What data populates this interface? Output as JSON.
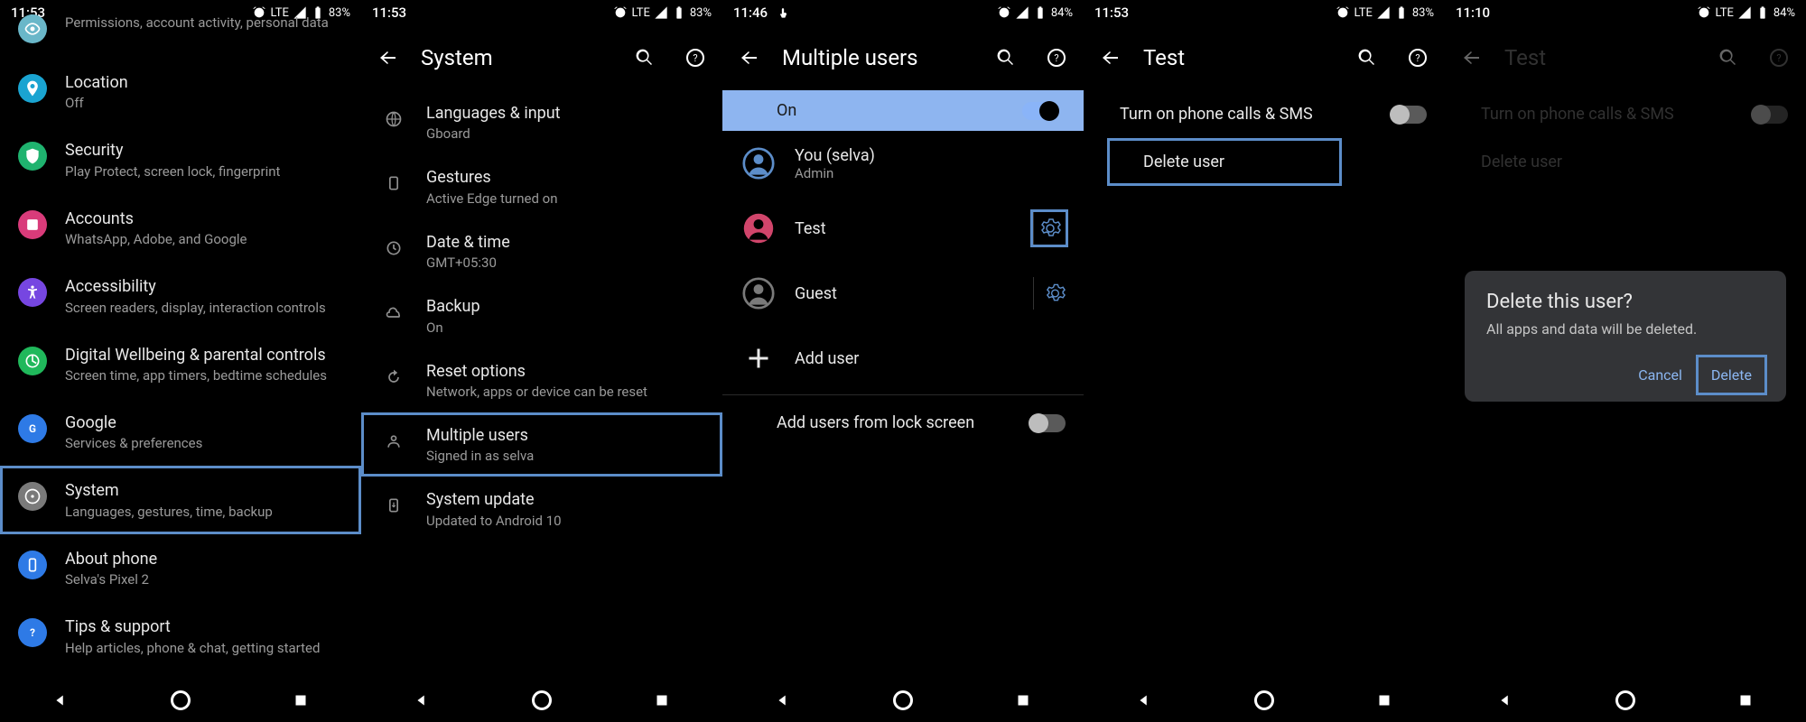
{
  "screens": [
    {
      "status": {
        "time": "11:53",
        "net": "LTE",
        "battery": "83%",
        "touch": false
      },
      "items": [
        {
          "icon_bg": "#6ab7c9",
          "label": "",
          "sub": "Permissions, account activity, personal data"
        },
        {
          "icon_bg": "#1aa4d1",
          "label": "Location",
          "sub": "Off"
        },
        {
          "icon_bg": "#1fb36f",
          "label": "Security",
          "sub": "Play Protect, screen lock, fingerprint"
        },
        {
          "icon_bg": "#d93b7a",
          "label": "Accounts",
          "sub": "WhatsApp, Adobe, and Google"
        },
        {
          "icon_bg": "#7646e1",
          "label": "Accessibility",
          "sub": "Screen readers, display, interaction controls"
        },
        {
          "icon_bg": "#20b85b",
          "label": "Digital Wellbeing & parental controls",
          "sub": "Screen time, app timers, bedtime schedules"
        },
        {
          "icon_bg": "#2e7ae6",
          "label": "Google",
          "sub": "Services & preferences"
        },
        {
          "icon_bg": "#7a7a7a",
          "label": "System",
          "sub": "Languages, gestures, time, backup",
          "hl": true
        },
        {
          "icon_bg": "#2e7ae6",
          "label": "About phone",
          "sub": "Selva's Pixel 2"
        },
        {
          "icon_bg": "#2e7ae6",
          "label": "Tips & support",
          "sub": "Help articles, phone & chat, getting started"
        }
      ]
    },
    {
      "status": {
        "time": "11:53",
        "net": "LTE",
        "battery": "83%",
        "touch": false
      },
      "title": "System",
      "items": [
        {
          "label": "Languages & input",
          "sub": "Gboard"
        },
        {
          "label": "Gestures",
          "sub": "Active Edge turned on"
        },
        {
          "label": "Date & time",
          "sub": "GMT+05:30"
        },
        {
          "label": "Backup",
          "sub": "On"
        },
        {
          "label": "Reset options",
          "sub": "Network, apps or device can be reset"
        },
        {
          "label": "Multiple users",
          "sub": "Signed in as selva",
          "hl": true
        },
        {
          "label": "System update",
          "sub": "Updated to Android 10"
        }
      ]
    },
    {
      "status": {
        "time": "11:46",
        "net": "",
        "battery": "84%",
        "touch": true
      },
      "title": "Multiple users",
      "toggle": {
        "label": "On",
        "state": "on"
      },
      "users": [
        {
          "name": "You (selva)",
          "sub": "Admin",
          "avatar": "you"
        },
        {
          "name": "Test",
          "sub": "",
          "avatar": "test",
          "gear_hl": true
        },
        {
          "name": "Guest",
          "sub": "",
          "avatar": "guest",
          "gear": true
        }
      ],
      "add": {
        "label": "Add user"
      },
      "lock": {
        "label": "Add users from lock screen",
        "state": "off"
      }
    },
    {
      "status": {
        "time": "11:53",
        "net": "LTE",
        "battery": "83%",
        "touch": false
      },
      "title": "Test",
      "items": [
        {
          "label": "Turn on phone calls & SMS",
          "switch": "off"
        },
        {
          "label": "Delete user",
          "hl": true
        }
      ]
    },
    {
      "status": {
        "time": "11:10",
        "net": "LTE",
        "battery": "84%",
        "touch": false
      },
      "title": "Test",
      "dim": true,
      "items": [
        {
          "label": "Turn on phone calls & SMS",
          "switch": "off"
        },
        {
          "label": "Delete user"
        }
      ],
      "dialog": {
        "title": "Delete this user?",
        "msg": "All apps and data will be deleted.",
        "cancel": "Cancel",
        "confirm": "Delete"
      }
    }
  ]
}
